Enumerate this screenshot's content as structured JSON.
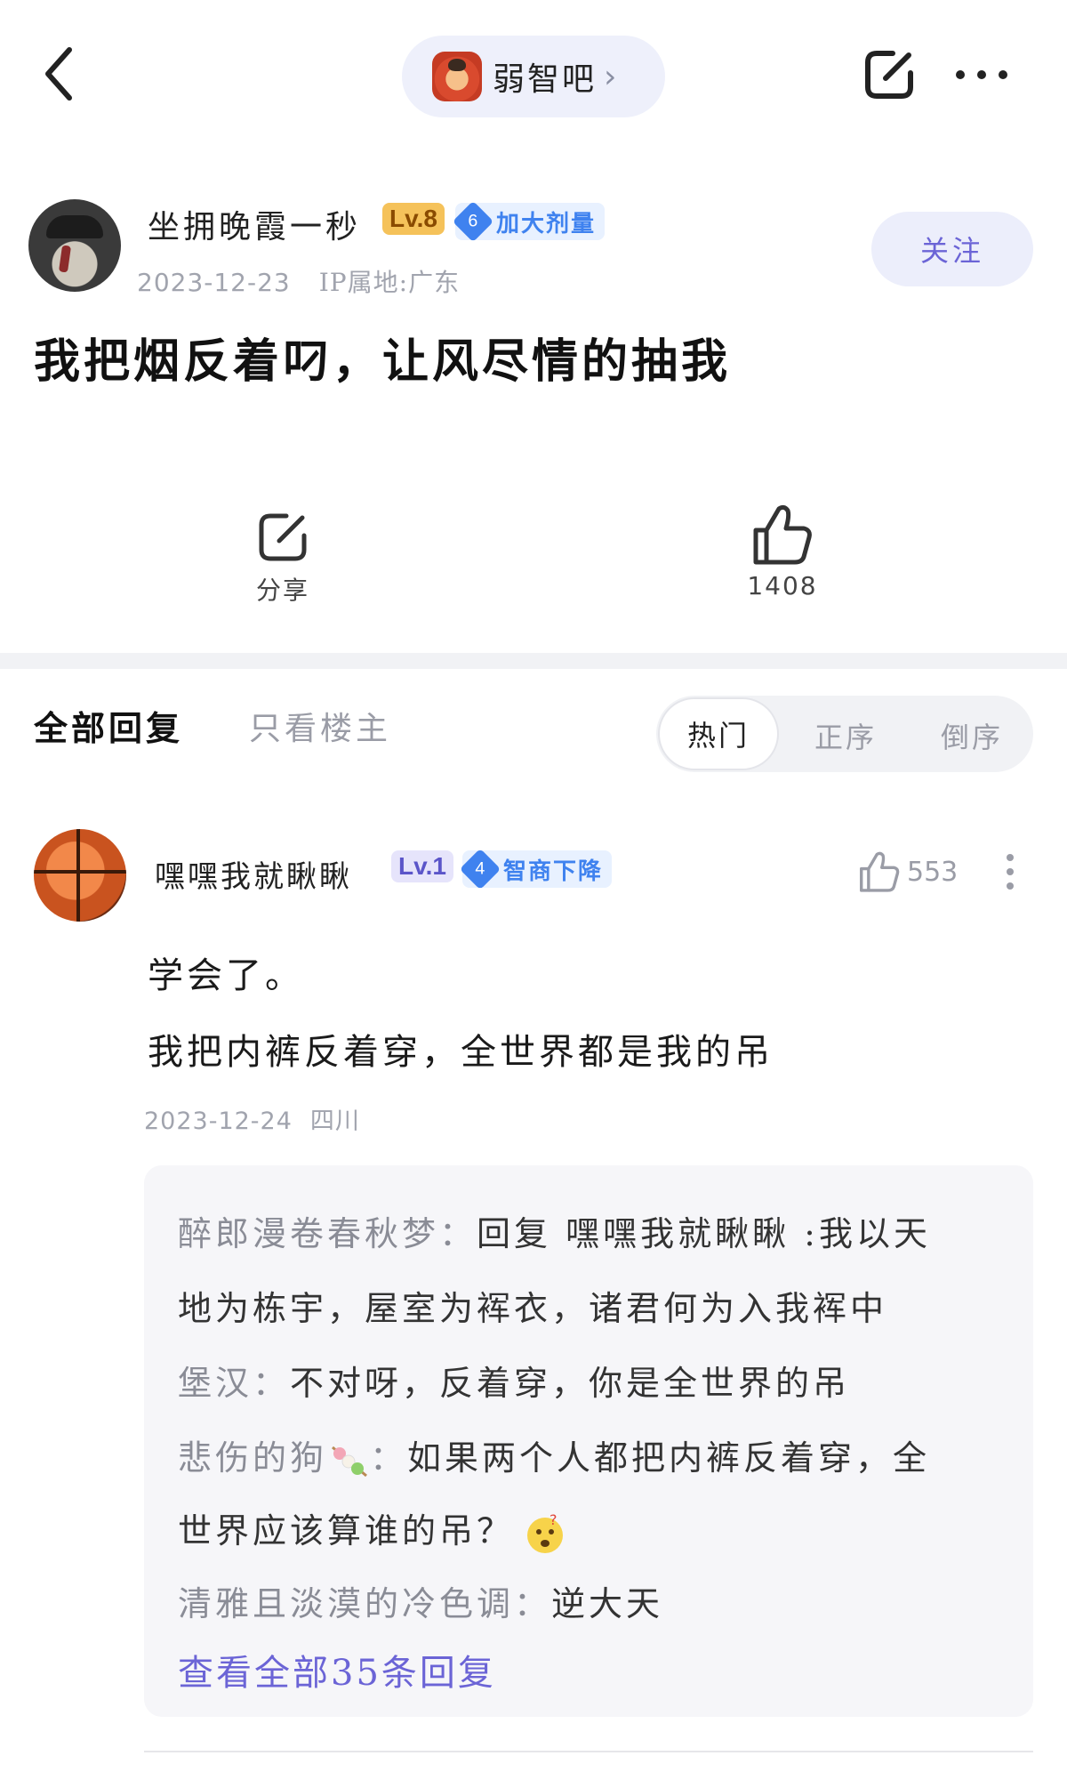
{
  "topbar": {
    "forum_name": "弱智吧",
    "back_icon": "chevron-left-icon",
    "edit_icon": "edit-icon",
    "more_icon": "more-horizontal-icon"
  },
  "post": {
    "author_name": "坐拥晚霞一秒",
    "level": "Lv.8",
    "medal_level": "6",
    "medal_title": "加大剂量",
    "date": "2023-12-23",
    "ip": "IP属地:广东",
    "follow_label": "关注",
    "title": "我把烟反着叼，让风尽情的抽我",
    "share_label": "分享",
    "like_count": "1408"
  },
  "tabs": {
    "all_replies": "全部回复",
    "op_only": "只看楼主",
    "sort_hot": "热门",
    "sort_asc": "正序",
    "sort_desc": "倒序"
  },
  "reply": {
    "author_name": "嘿嘿我就瞅瞅",
    "level": "Lv.1",
    "medal_level": "4",
    "medal_title": "智商下降",
    "like_count": "553",
    "line1": "学会了。",
    "line2": "我把内裤反着穿，全世界都是我的吊",
    "date": "2023-12-24",
    "location": "四川",
    "sub_replies": [
      {
        "who": "醉郎漫卷春秋梦：",
        "text_l1": "回复 嘿嘿我就瞅瞅 :我以天",
        "text_l2": "地为栋宇，屋室为裈衣，诸君何为入我裈中"
      },
      {
        "who": "堡汉：",
        "text_l1": "不对呀，反着穿，你是全世界的吊"
      },
      {
        "who_prefix": "悲伤的狗",
        "who_suffix": "：",
        "text_l1": "如果两个人都把内裤反着穿，全",
        "text_l2": "世界应该算谁的吊？"
      },
      {
        "who": "清雅且淡漠的冷色调：",
        "text_l1": "逆大天"
      }
    ],
    "view_all": "查看全部35条回复"
  }
}
